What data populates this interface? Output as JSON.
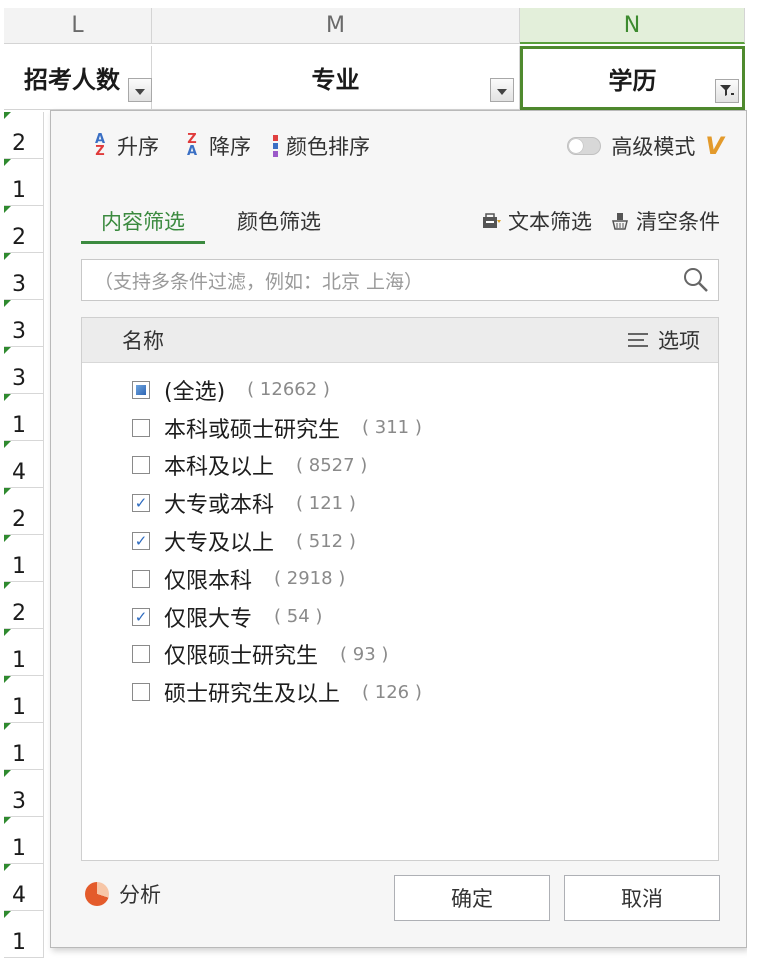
{
  "columns": {
    "L": "L",
    "M": "M",
    "N": "N"
  },
  "headers": {
    "col_l": "招考人数",
    "col_m": "专业",
    "col_n": "学历"
  },
  "row_numbers": [
    "2",
    "1",
    "2",
    "3",
    "3",
    "3",
    "1",
    "4",
    "2",
    "1",
    "2",
    "1",
    "1",
    "1",
    "3",
    "1",
    "4",
    "1"
  ],
  "sort": {
    "ascending": "升序",
    "descending": "降序",
    "color_sort": "颜色排序",
    "advanced_mode": "高级模式",
    "vip_mark": "V"
  },
  "tabs": {
    "content_filter": "内容筛选",
    "color_filter": "颜色筛选",
    "text_filter": "文本筛选",
    "clear_conditions": "清空条件"
  },
  "search": {
    "placeholder": "（支持多条件过滤，例如：北京 上海）"
  },
  "list": {
    "header_name": "名称",
    "header_options": "选项",
    "items": [
      {
        "label": "(全选)",
        "count": "( 12662 )",
        "state": "partial"
      },
      {
        "label": "本科或硕士研究生",
        "count": "( 311 )",
        "state": "unchecked"
      },
      {
        "label": "本科及以上",
        "count": "( 8527 )",
        "state": "unchecked"
      },
      {
        "label": "大专或本科",
        "count": "( 121 )",
        "state": "checked"
      },
      {
        "label": "大专及以上",
        "count": "( 512 )",
        "state": "checked"
      },
      {
        "label": "仅限本科",
        "count": "( 2918 )",
        "state": "unchecked"
      },
      {
        "label": "仅限大专",
        "count": "( 54 )",
        "state": "checked"
      },
      {
        "label": "仅限硕士研究生",
        "count": "( 93 )",
        "state": "unchecked"
      },
      {
        "label": "硕士研究生及以上",
        "count": "( 126 )",
        "state": "unchecked"
      }
    ]
  },
  "footer": {
    "analyze": "分析",
    "confirm": "确定",
    "cancel": "取消"
  },
  "icons": {
    "asc": "sort-ascending-icon",
    "desc": "sort-descending-icon",
    "color_sort": "color-sort-icon",
    "text_filter": "text-filter-icon",
    "clear": "clear-filter-icon",
    "search": "search-icon",
    "options": "options-icon",
    "analyze": "pie-chart-icon",
    "filter": "filter-icon"
  },
  "colors": {
    "accent_green": "#3b8a3f",
    "sort_red": "#e03b3b",
    "sort_blue": "#3a6fc4",
    "vip_orange": "#e39a2b"
  }
}
